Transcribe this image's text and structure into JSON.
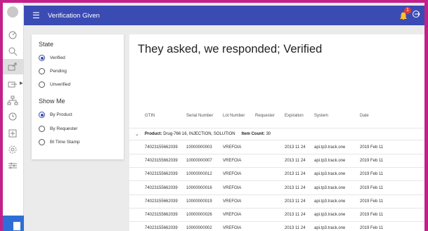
{
  "topbar": {
    "title": "Verification Given",
    "notification_count": "1"
  },
  "filter": {
    "state_heading": "State",
    "state_options": [
      "Verified",
      "Pending",
      "Unverified"
    ],
    "show_heading": "Show Me",
    "show_options": [
      "By Product",
      "By Requester",
      "Bt Time Stamp"
    ]
  },
  "main": {
    "heading": "They asked, we responded; Verified",
    "columns": [
      "GTIN",
      "Serial Number",
      "Lot Number",
      "Requester",
      "Expiration",
      "System",
      "Date"
    ],
    "group": {
      "product_label": "Product:",
      "product_value": "Drug-766 16, INJECTION, SOLUTION",
      "count_label": "Item Count:",
      "count_value": "30"
    },
    "rows": [
      [
        "74023155662039",
        "10000000003",
        "VREFOIA",
        "",
        "2013 11 24",
        "api.tp3.track.one",
        "2019 Feb 11"
      ],
      [
        "74023155662039",
        "10000000007",
        "VREFOIA",
        "",
        "2013 11 24",
        "api.tp3.track.one",
        "2019 Feb 11"
      ],
      [
        "74023155662039",
        "10000000012",
        "VREFOIA",
        "",
        "2013 11 24",
        "api.tp3.track.one",
        "2019 Feb 11"
      ],
      [
        "74023155662039",
        "10000000016",
        "VREFOIA",
        "",
        "2013 11 24",
        "api.tp3.track.one",
        "2019 Feb 11"
      ],
      [
        "74023155662039",
        "10000000019",
        "VREFOIA",
        "",
        "2013 11 24",
        "api.tp3.track.one",
        "2019 Feb 11"
      ],
      [
        "74023155662039",
        "10000000026",
        "VREFOIA",
        "",
        "2013 11 24",
        "api.tp3.track.one",
        "2019 Feb 11"
      ],
      [
        "74023155662039",
        "10000000002",
        "VREFOIA",
        "",
        "2013 11 24",
        "api.tp3.track.one",
        "2019 Feb 11"
      ]
    ]
  }
}
